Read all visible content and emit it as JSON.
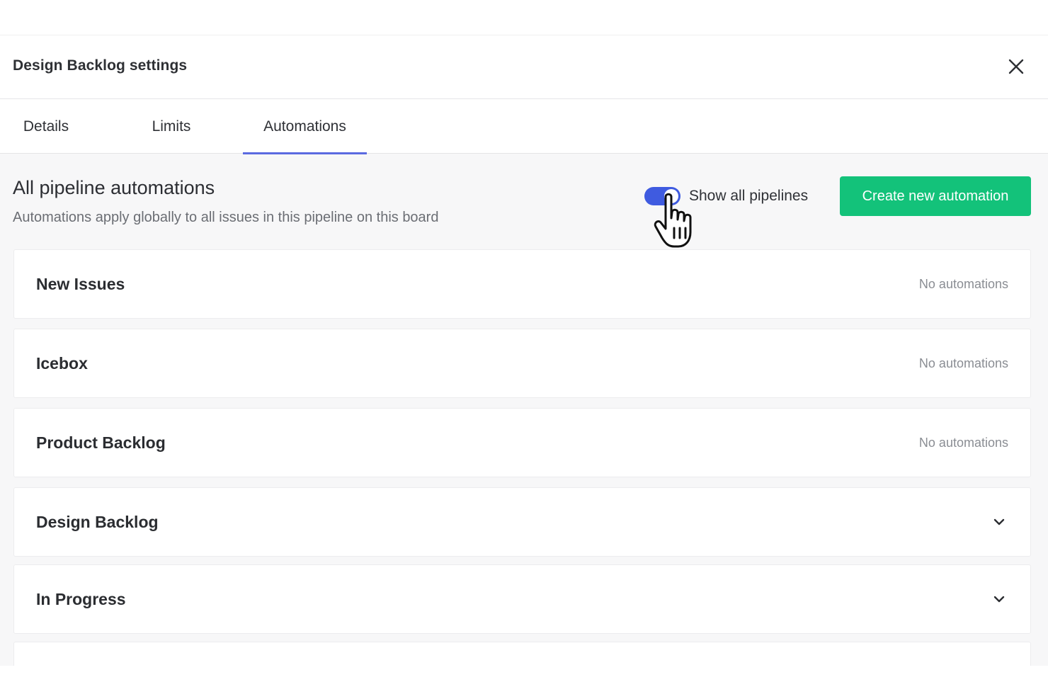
{
  "modal": {
    "title": "Design Backlog settings",
    "close_icon": "close-icon"
  },
  "tabs": [
    {
      "label": "Details",
      "active": false
    },
    {
      "label": "Limits",
      "active": false
    },
    {
      "label": "Automations",
      "active": true
    }
  ],
  "section": {
    "title": "All pipeline automations",
    "description": "Automations apply globally to all issues in this pipeline on this board"
  },
  "toggle": {
    "label": "Show all pipelines",
    "on": true
  },
  "create_button": {
    "label": "Create new automation"
  },
  "pipelines": [
    {
      "name": "New Issues",
      "status": "No automations",
      "expandable": false
    },
    {
      "name": "Icebox",
      "status": "No automations",
      "expandable": false
    },
    {
      "name": "Product Backlog",
      "status": "No automations",
      "expandable": false
    },
    {
      "name": "Design Backlog",
      "status": "",
      "expandable": true
    },
    {
      "name": "In Progress",
      "status": "",
      "expandable": true
    },
    {
      "name": "",
      "status": "",
      "expandable": false
    }
  ],
  "colors": {
    "accent": "#5b6ae0",
    "toggle": "#3f5be0",
    "primary_button": "#13c27a",
    "background": "#f7f7f8"
  }
}
